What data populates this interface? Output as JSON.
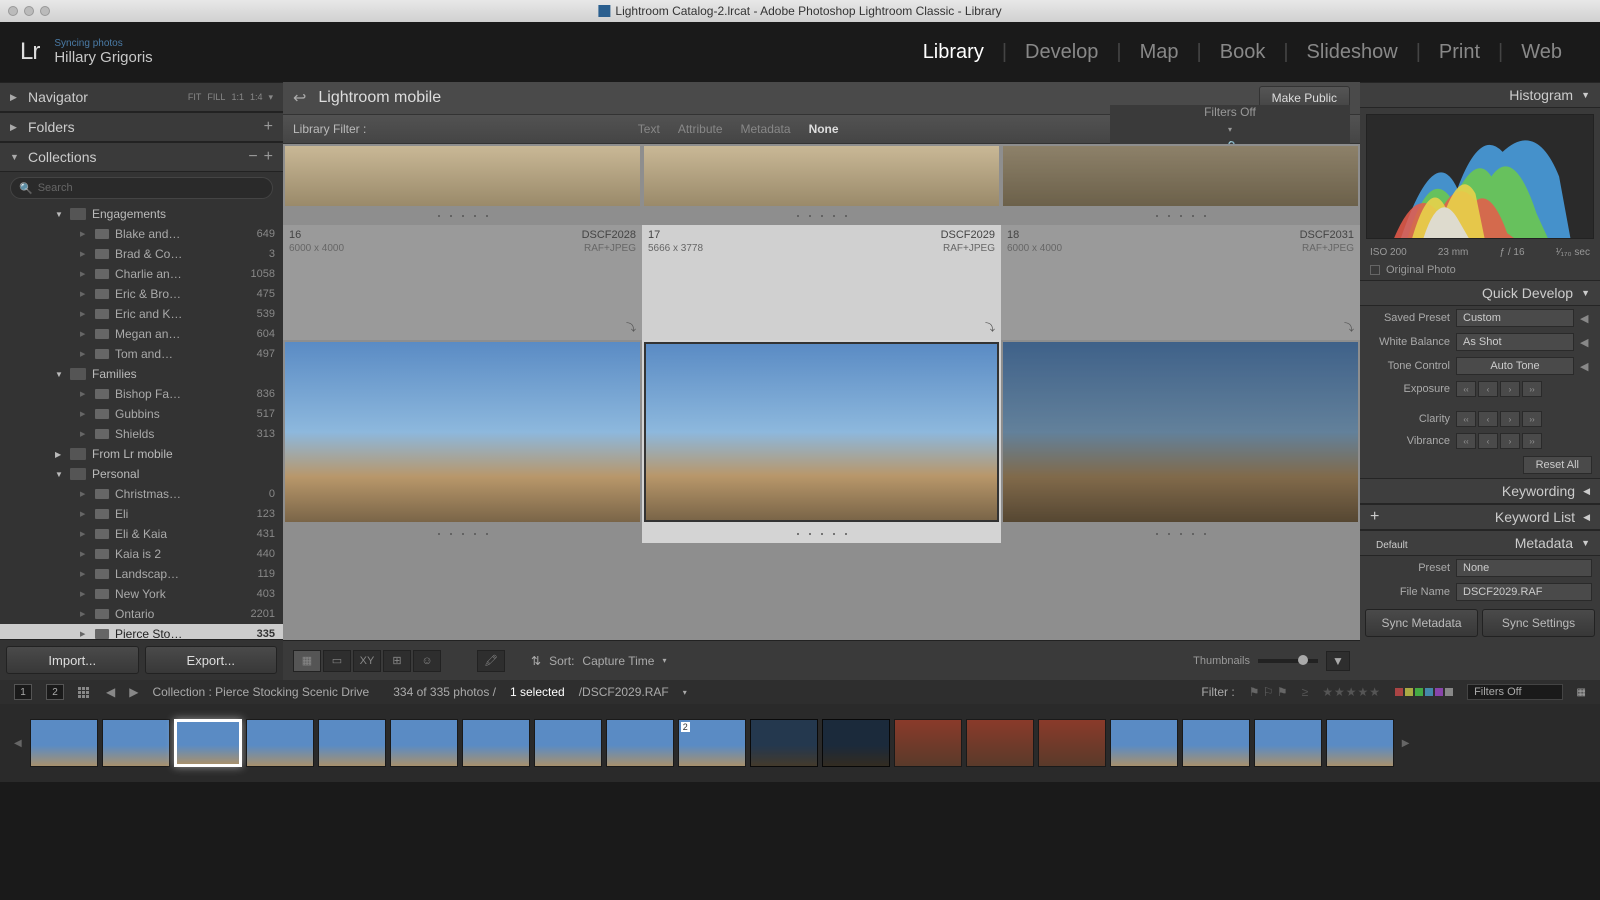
{
  "titlebar": {
    "text": "Lightroom Catalog-2.lrcat - Adobe Photoshop Lightroom Classic - Library"
  },
  "identity": {
    "sync": "Syncing photos",
    "user": "Hillary Grigoris",
    "logo": "Lr"
  },
  "modules": {
    "library": "Library",
    "develop": "Develop",
    "map": "Map",
    "book": "Book",
    "slideshow": "Slideshow",
    "print": "Print",
    "web": "Web"
  },
  "left": {
    "navigator": "Navigator",
    "nav_fit": "FIT",
    "nav_fill": "FILL",
    "nav_1_1": "1:1",
    "nav_1_4": "1:4",
    "folders": "Folders",
    "collections": "Collections",
    "search_ph": "Search",
    "import": "Import...",
    "export": "Export...",
    "tree": [
      {
        "t": "group",
        "name": "Engagements"
      },
      {
        "t": "child",
        "name": "Blake and…",
        "count": "649"
      },
      {
        "t": "child",
        "name": "Brad & Co…",
        "count": "3"
      },
      {
        "t": "child",
        "name": "Charlie an…",
        "count": "1058"
      },
      {
        "t": "child",
        "name": "Eric & Bro…",
        "count": "475"
      },
      {
        "t": "child",
        "name": "Eric and K…",
        "count": "539"
      },
      {
        "t": "child",
        "name": "Megan an…",
        "count": "604"
      },
      {
        "t": "child",
        "name": "Tom and…",
        "count": "497"
      },
      {
        "t": "group",
        "name": "Families"
      },
      {
        "t": "child",
        "name": "Bishop Fa…",
        "count": "836"
      },
      {
        "t": "child",
        "name": "Gubbins",
        "count": "517"
      },
      {
        "t": "child",
        "name": "Shields",
        "count": "313"
      },
      {
        "t": "group",
        "name": "From Lr mobile",
        "closed": true
      },
      {
        "t": "group",
        "name": "Personal"
      },
      {
        "t": "child",
        "name": "Christmas…",
        "count": "0"
      },
      {
        "t": "child",
        "name": "Eli",
        "count": "123"
      },
      {
        "t": "child",
        "name": "Eli & Kaia",
        "count": "431"
      },
      {
        "t": "child",
        "name": "Kaia is 2",
        "count": "440"
      },
      {
        "t": "child",
        "name": "Landscap…",
        "count": "119"
      },
      {
        "t": "child",
        "name": "New York",
        "count": "403"
      },
      {
        "t": "child",
        "name": "Ontario",
        "count": "2201"
      },
      {
        "t": "child",
        "name": "Pierce Sto…",
        "count": "335",
        "sel": true
      }
    ]
  },
  "center": {
    "breadcrumb": "Lightroom mobile",
    "make_public": "Make Public",
    "filter_label": "Library Filter :",
    "filt_text": "Text",
    "filt_attr": "Attribute",
    "filt_meta": "Metadata",
    "filt_none": "None",
    "filters_off": "Filters Off",
    "cells": [
      {
        "idx": "16",
        "file": "DSCF2028",
        "dims": "6000 x 4000",
        "fmt": "RAF+JPEG"
      },
      {
        "idx": "17",
        "file": "DSCF2029",
        "dims": "5666 x 3778",
        "fmt": "RAF+JPEG",
        "sel": true
      },
      {
        "idx": "18",
        "file": "DSCF2031",
        "dims": "6000 x 4000",
        "fmt": "RAF+JPEG"
      }
    ],
    "sort_label": "Sort:",
    "sort_value": "Capture Time",
    "thumbnails": "Thumbnails"
  },
  "right": {
    "histogram": "Histogram",
    "iso": "ISO 200",
    "focal": "23 mm",
    "ap": "ƒ / 16",
    "shutter": "¹⁄₁₇₀ sec",
    "orig": "Original Photo",
    "quick_develop": "Quick Develop",
    "saved_preset": "Saved Preset",
    "preset_val": "Custom",
    "wb": "White Balance",
    "wb_val": "As Shot",
    "tone": "Tone Control",
    "auto": "Auto Tone",
    "exposure": "Exposure",
    "clarity": "Clarity",
    "vibrance": "Vibrance",
    "reset": "Reset All",
    "keywording": "Keywording",
    "keyword_list": "Keyword List",
    "metadata": "Metadata",
    "default": "Default",
    "preset": "Preset",
    "preset_none": "None",
    "filename": "File Name",
    "filename_val": "DSCF2029.RAF",
    "sync_meta": "Sync Metadata",
    "sync_settings": "Sync Settings"
  },
  "infobar": {
    "n1": "1",
    "n2": "2",
    "collection": "Collection : Pierce Stocking Scenic Drive",
    "count": "334 of 335 photos /",
    "sel": "1 selected",
    "file": "/DSCF2029.RAF",
    "filter": "Filter :",
    "filters_off": "Filters Off"
  }
}
